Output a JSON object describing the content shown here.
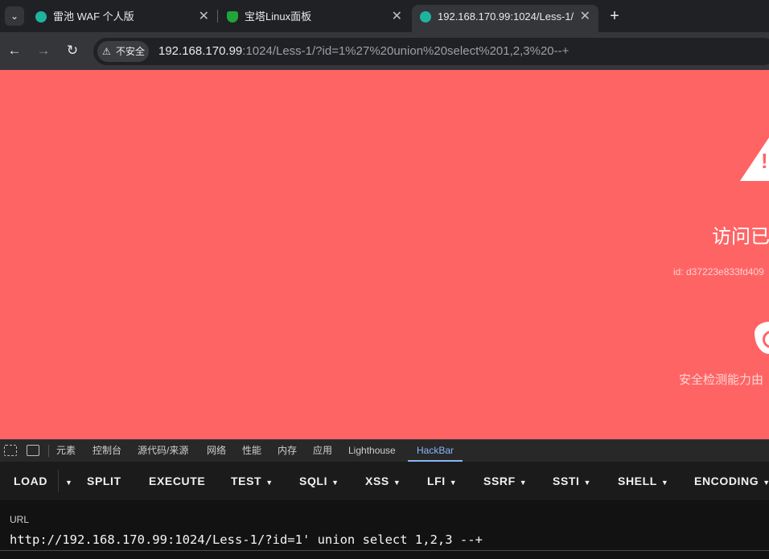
{
  "browser": {
    "tabs": [
      {
        "title": "雷池 WAF 个人版",
        "close": "✕"
      },
      {
        "title": "宝塔Linux面板",
        "close": "✕"
      },
      {
        "title": "192.168.170.99:1024/Less-1/",
        "close": "✕"
      }
    ],
    "new_tab": "+",
    "menu_icon": "⌄",
    "nav": {
      "back": "←",
      "forward": "→",
      "reload": "↻"
    },
    "security_chip": {
      "icon": "⚠",
      "label": "不安全"
    },
    "url_host": "192.168.170.99",
    "url_rest": ":1024/Less-1/?id=1%27%20union%20select%201,2,3%20--+"
  },
  "block_page": {
    "title": "访问已",
    "request_id": "id: d37223e833fd409",
    "powered_by": "安全检测能力由",
    "bg_color": "#ff6464"
  },
  "devtools": {
    "tabs": [
      "元素",
      "控制台",
      "源代码/来源",
      "网络",
      "性能",
      "内存",
      "应用",
      "Lighthouse",
      "HackBar"
    ],
    "active_tab": "HackBar"
  },
  "hackbar": {
    "buttons": [
      "LOAD",
      "SPLIT",
      "EXECUTE",
      "TEST",
      "SQLI",
      "XSS",
      "LFI",
      "SSRF",
      "SSTI",
      "SHELL",
      "ENCODING"
    ],
    "url_label": "URL",
    "url_value": "http://192.168.170.99:1024/Less-1/?id=1' union select 1,2,3 --+"
  }
}
